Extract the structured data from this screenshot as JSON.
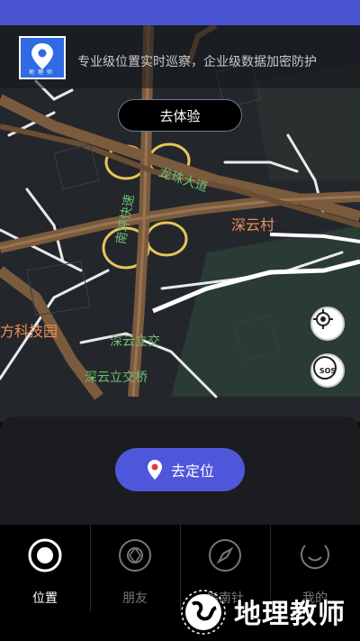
{
  "header": {
    "slogan": "专业级位置实时巡察，企业级数据加密防护",
    "logo_caption": "地理师"
  },
  "map": {
    "try_button_label": "去体验",
    "place_labels": [
      "深云村",
      "方科技园"
    ],
    "road_labels": [
      "龙珠大道",
      "南坪快速",
      "深云立交",
      "深云立交桥"
    ]
  },
  "controls": {
    "locate_target_icon": "crosshair-icon",
    "sos_label": "SOS"
  },
  "action": {
    "locate_label": "去定位",
    "accent": "#4e57d9"
  },
  "tabs": [
    {
      "label": "位置",
      "icon": "target-icon",
      "active": true
    },
    {
      "label": "朋友",
      "icon": "aperture-icon",
      "active": false
    },
    {
      "label": "指南针",
      "icon": "compass-icon",
      "active": false
    },
    {
      "label": "我的",
      "icon": "smile-icon",
      "active": false
    }
  ],
  "watermark": {
    "text": "地理教师"
  }
}
